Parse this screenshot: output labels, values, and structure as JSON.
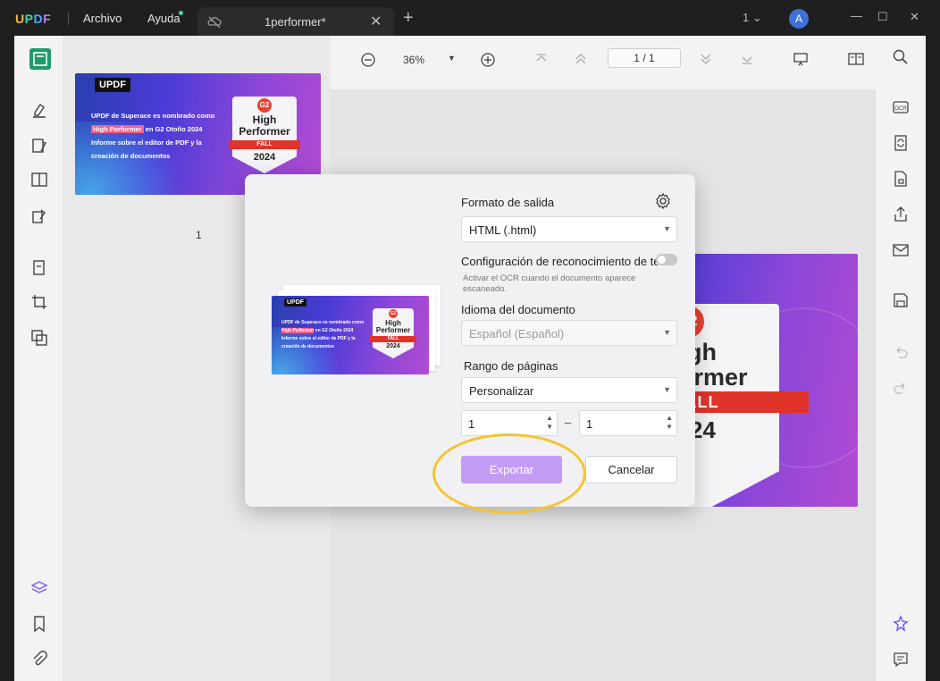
{
  "app": {
    "logo": {
      "u": "U",
      "p": "P",
      "d": "D",
      "f": "F"
    }
  },
  "menu": {
    "file": "Archivo",
    "help": "Ayuda"
  },
  "tab": {
    "title": "1performer*"
  },
  "titlebar": {
    "page_count": "1",
    "avatar_letter": "A"
  },
  "toolbar": {
    "zoom": "36%",
    "page_current": "1",
    "page_sep": "/",
    "page_total": "1"
  },
  "thumbnail": {
    "page_number": "1",
    "logo": "UPDF",
    "line1": "UPDF de Superace es nombrado como",
    "highlight": "High Performer",
    "line2": "en G2 Otoño 2024",
    "line3": "Informe sobre el editor de PDF y la",
    "line4": "creación de documentos",
    "badge": {
      "g2": "G2",
      "title1": "High",
      "title2": "Performer",
      "season": "FALL",
      "year": "2024"
    }
  },
  "page_badge": {
    "g2": "G2",
    "title1": "High",
    "title2": "Performer",
    "season": "FALL",
    "year": "2024"
  },
  "dialog": {
    "output_format_label": "Formato de salida",
    "output_format_value": "HTML (.html)",
    "ocr_label": "Configuración de reconocimiento de te...",
    "ocr_hint_1": "Activar el OCR cuando el documento aparece",
    "ocr_hint_2": "escaneado.",
    "language_label": "Idioma del documento",
    "language_value": "Español (Español)",
    "range_label": "Rango de páginas",
    "range_value": "Personalizar",
    "range_from": "1",
    "range_dash": "–",
    "range_to": "1",
    "export_label": "Exportar",
    "cancel_label": "Cancelar"
  },
  "colors": {
    "accent": "#c59cf5",
    "highlight_ring": "#f2c530",
    "brand_red": "#e0332a"
  }
}
